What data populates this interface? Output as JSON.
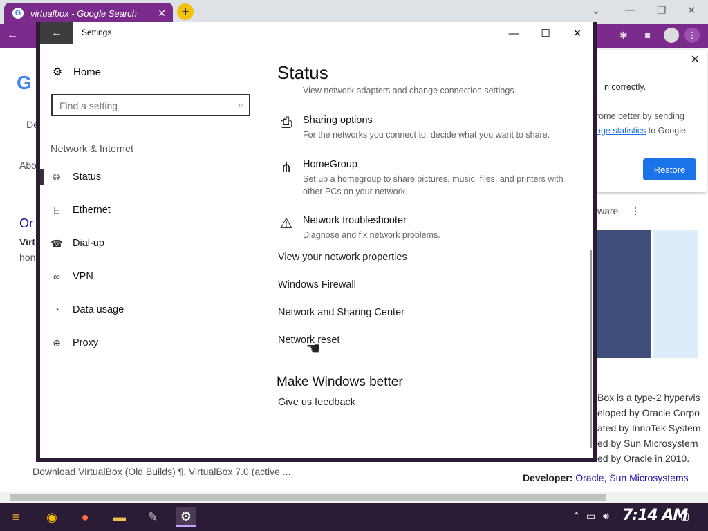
{
  "browser": {
    "tab_title": "virtualbox - Google Search",
    "logo_fragment": "G",
    "fragments": [
      "De",
      "Abo",
      "Or",
      "Virt",
      "hon"
    ],
    "restore_card": {
      "line1": "n correctly.",
      "line2": "rome better by sending",
      "line3_link": "age statistics",
      "line3_rest": " to Google",
      "button": "Restore"
    },
    "kp_header": "ware",
    "kp_lines": [
      "Box is a type-2 hypervis",
      "eloped by Oracle Corpo",
      "ated by InnoTek System",
      "ed by Sun Microsystem",
      "ed by Oracle in 2010."
    ],
    "developer_label": "Developer:",
    "developer_links": "Oracle, Sun Microsystems",
    "bottom_snippet": "Download VirtualBox (Old Builds) ¶. VirtualBox 7.0 (active ..."
  },
  "settings": {
    "window_title": "Settings",
    "home": "Home",
    "search_placeholder": "Find a setting",
    "group_heading": "Network & Internet",
    "nav": [
      {
        "label": "Status",
        "icon": "globe-icon"
      },
      {
        "label": "Ethernet",
        "icon": "ethernet-icon"
      },
      {
        "label": "Dial-up",
        "icon": "dialup-icon"
      },
      {
        "label": "VPN",
        "icon": "vpn-icon"
      },
      {
        "label": "Data usage",
        "icon": "data-usage-icon"
      },
      {
        "label": "Proxy",
        "icon": "globe-icon"
      }
    ],
    "page_title": "Status",
    "cut_description": "View network adapters and change connection settings.",
    "options": [
      {
        "title": "Sharing options",
        "desc": "For the networks you connect to, decide what you want to share.",
        "icon": "sharing-icon"
      },
      {
        "title": "HomeGroup",
        "desc": "Set up a homegroup to share pictures, music, files, and printers with other PCs on your network.",
        "icon": "homegroup-icon"
      },
      {
        "title": "Network troubleshooter",
        "desc": "Diagnose and fix network problems.",
        "icon": "warning-icon"
      }
    ],
    "links": [
      "View your network properties",
      "Windows Firewall",
      "Network and Sharing Center",
      "Network reset"
    ],
    "section_title": "Make Windows better",
    "feedback_link": "Give us feedback"
  },
  "taskbar": {
    "clock": "7:14 AM"
  }
}
